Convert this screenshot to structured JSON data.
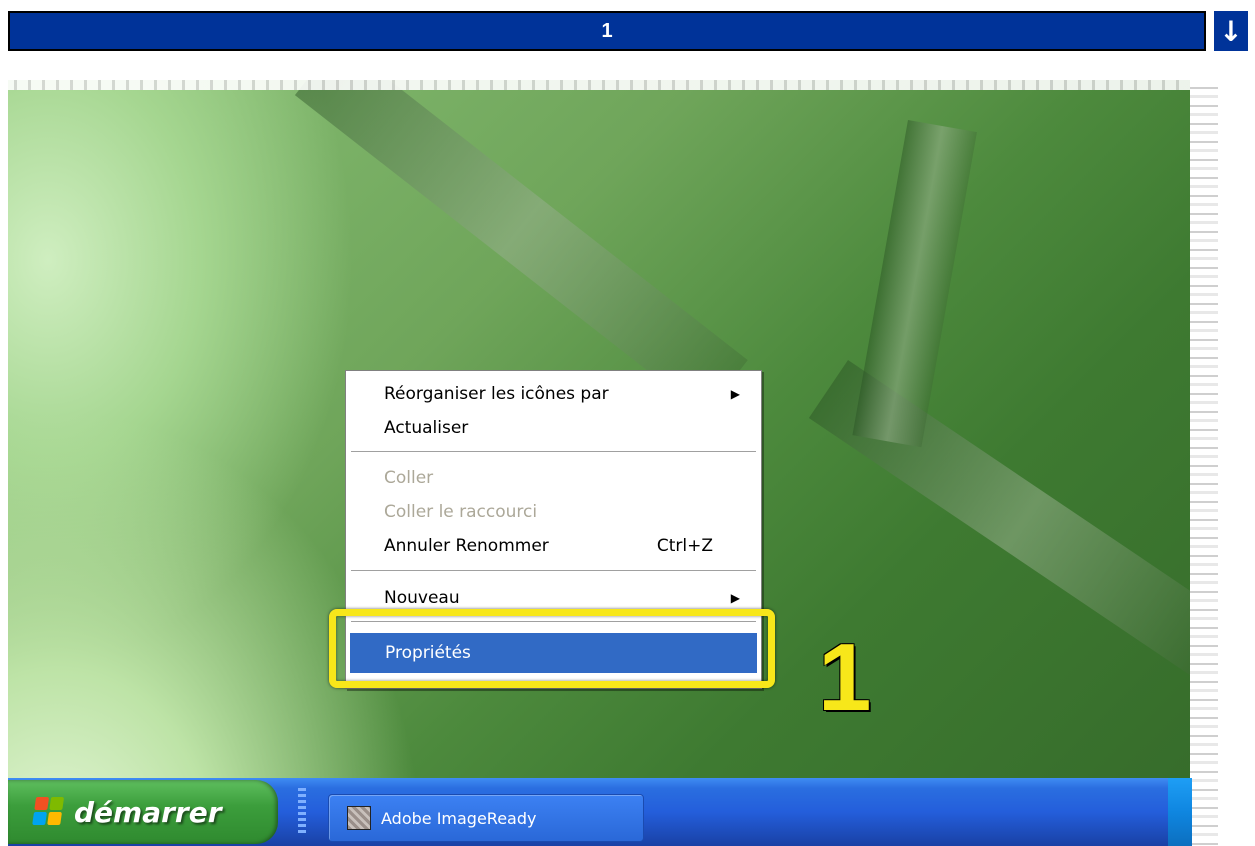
{
  "step_bar": {
    "title": "1",
    "down_arrow": "↓"
  },
  "context_menu": {
    "items": [
      {
        "label": "Réorganiser les icônes par",
        "submenu": true,
        "disabled": false
      },
      {
        "label": "Actualiser",
        "disabled": false
      },
      {
        "label": "Coller",
        "disabled": true
      },
      {
        "label": "Coller le raccourci",
        "disabled": true
      },
      {
        "label": "Annuler Renommer",
        "shortcut": "Ctrl+Z",
        "disabled": false
      },
      {
        "label": "Nouveau",
        "submenu": true,
        "disabled": false
      },
      {
        "label": "Propriétés",
        "selected": true,
        "disabled": false
      }
    ],
    "submenu_arrow": "▶"
  },
  "annotation": {
    "step_number": "1",
    "highlight_color": "#f7e71a"
  },
  "taskbar": {
    "start_label": "démarrer",
    "tasks": [
      {
        "label": "Adobe ImageReady",
        "icon": "imageready-icon"
      }
    ]
  },
  "colors": {
    "step_bar_bg": "#003399",
    "menu_selection": "#316ac5",
    "taskbar_blue": "#245edb",
    "start_green": "#3c9e3c"
  }
}
